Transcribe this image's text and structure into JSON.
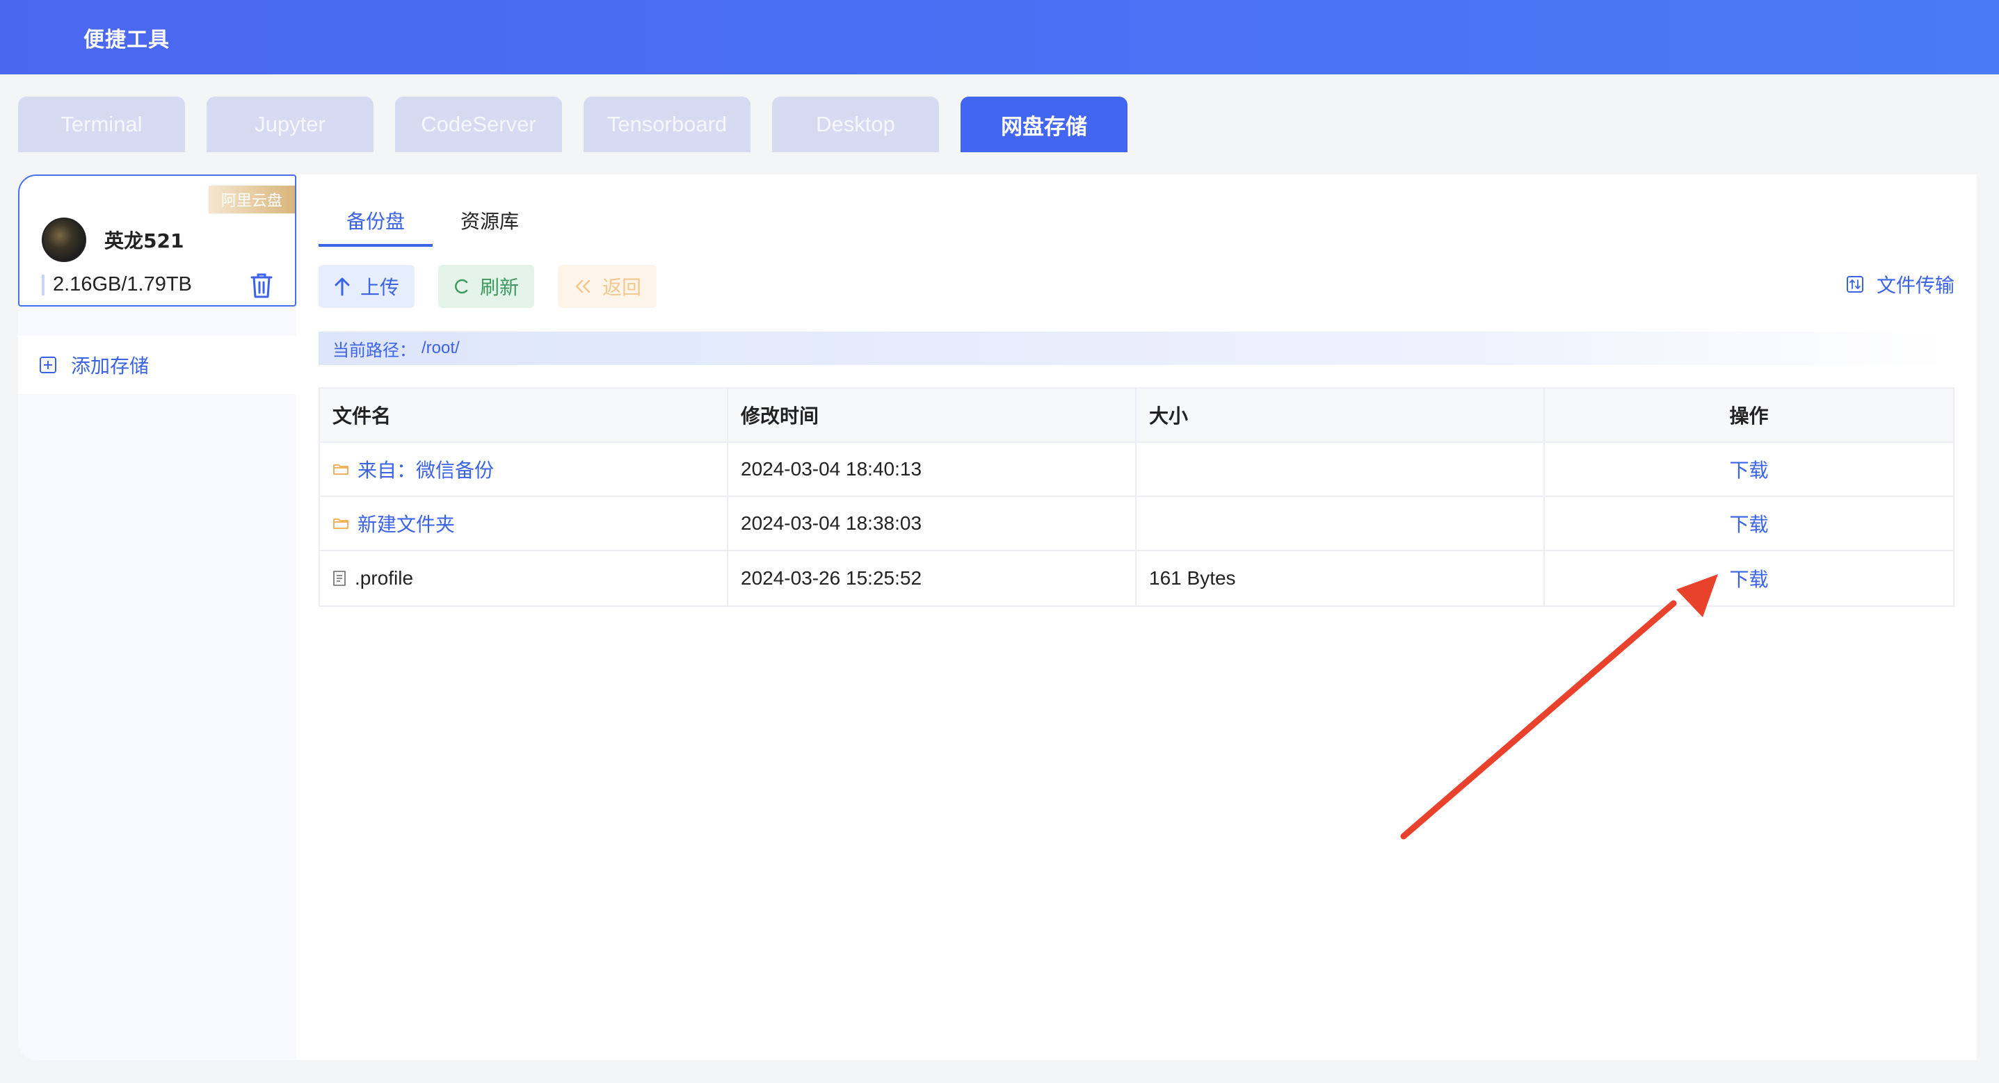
{
  "app": {
    "title": "便捷工具"
  },
  "tabs": [
    {
      "label": "Terminal",
      "active": false
    },
    {
      "label": "Jupyter",
      "active": false
    },
    {
      "label": "CodeServer",
      "active": false
    },
    {
      "label": "Tensorboard",
      "active": false
    },
    {
      "label": "Desktop",
      "active": false
    },
    {
      "label": "网盘存储",
      "active": true
    }
  ],
  "sidebar": {
    "account": {
      "badge": "阿里云盘",
      "name": "英龙521",
      "storage": "2.16GB/1.79TB"
    },
    "add_storage_label": "添加存储"
  },
  "main": {
    "subtabs": [
      {
        "label": "备份盘",
        "active": true
      },
      {
        "label": "资源库",
        "active": false
      }
    ],
    "toolbar": {
      "upload_label": "上传",
      "refresh_label": "刷新",
      "back_label": "返回",
      "transfer_label": "文件传输"
    },
    "path": {
      "label": "当前路径：",
      "value": "/root/"
    },
    "table": {
      "headers": [
        "文件名",
        "修改时间",
        "大小",
        "操作"
      ],
      "rows": [
        {
          "type": "folder",
          "name": "来自：微信备份",
          "modified": "2024-03-04 18:40:13",
          "size": "",
          "action": "下载"
        },
        {
          "type": "folder",
          "name": "新建文件夹",
          "modified": "2024-03-04 18:38:03",
          "size": "",
          "action": "下载"
        },
        {
          "type": "file",
          "name": ".profile",
          "modified": "2024-03-26 15:25:52",
          "size": "161 Bytes",
          "action": "下载"
        }
      ]
    }
  },
  "colors": {
    "accent": "#3b63e6",
    "topbar": "#4a6ef2",
    "annotation_arrow": "#e8412c",
    "folder_icon": "#f0a94a"
  }
}
